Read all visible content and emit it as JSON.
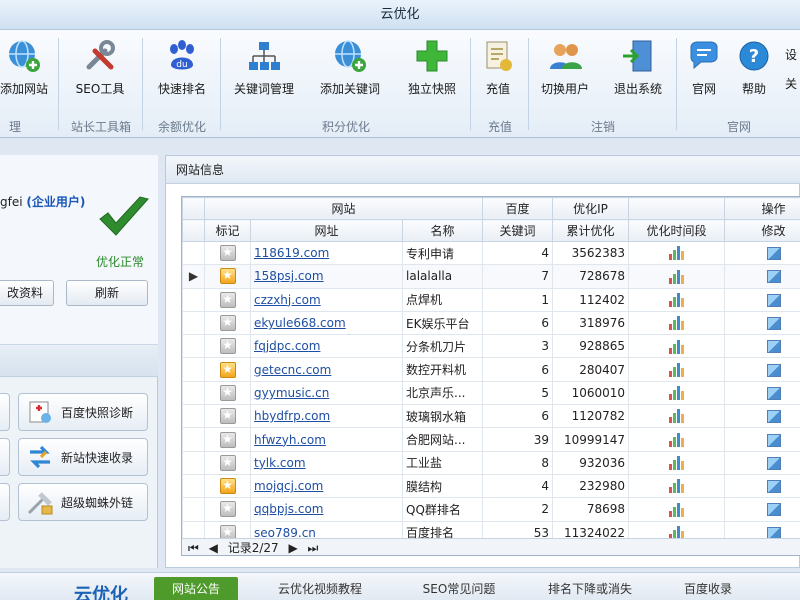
{
  "window": {
    "title": "云优化"
  },
  "ribbon": {
    "buttons": [
      {
        "label": "添加网站",
        "icon": "globe-add-icon"
      },
      {
        "label": "SEO工具",
        "icon": "tools-icon"
      },
      {
        "label": "快速排名",
        "icon": "baidu-paw-icon"
      },
      {
        "label": "关键词管理",
        "icon": "sitemap-icon"
      },
      {
        "label": "添加关键词",
        "icon": "globe-add-icon"
      },
      {
        "label": "独立快照",
        "icon": "plus-icon"
      },
      {
        "label": "充值",
        "icon": "document-icon"
      },
      {
        "label": "切换用户",
        "icon": "users-icon"
      },
      {
        "label": "退出系统",
        "icon": "exit-icon"
      },
      {
        "label": "官网",
        "icon": "chat-bubble-icon"
      },
      {
        "label": "帮助",
        "icon": "help-icon"
      },
      {
        "label": "设",
        "icon": ""
      }
    ],
    "groups": [
      "理",
      "站长工具箱",
      "余额优化",
      "积分优化",
      "充值",
      "注销",
      "官网"
    ],
    "edge_text": "关"
  },
  "user": {
    "name_prefix": "gfei",
    "vip_label": "(企业用户)",
    "status": "优化正常",
    "edit_profile_label": "改资料",
    "refresh_label": "刷新"
  },
  "left_tools": [
    {
      "label": "百度快照诊断"
    },
    {
      "label": "新站快速收录"
    },
    {
      "label": "超级蜘蛛外链"
    }
  ],
  "panel": {
    "title": "网站信息",
    "group_headers": {
      "site": "网站",
      "baidu": "百度",
      "ip": "优化IP",
      "ops": "操作"
    },
    "columns": {
      "mark": "标记",
      "url": "网址",
      "name": "名称",
      "keywords": "关键词",
      "total": "累计优化",
      "timespan": "优化时间段",
      "edit": "修改"
    },
    "rows": [
      {
        "star": "grey",
        "url": "118619.com",
        "name": "专利申请",
        "keywords": "4",
        "total": "3562383"
      },
      {
        "star": "gold",
        "url": "158psj.com",
        "name": "lalalalla",
        "keywords": "7",
        "total": "728678"
      },
      {
        "star": "grey",
        "url": "czzxhj.com",
        "name": "点焊机",
        "keywords": "1",
        "total": "112402"
      },
      {
        "star": "grey",
        "url": "ekyule668.com",
        "name": "EK娱乐平台",
        "keywords": "6",
        "total": "318976"
      },
      {
        "star": "grey",
        "url": "fqjdpc.com",
        "name": "分条机刀片",
        "keywords": "3",
        "total": "928865"
      },
      {
        "star": "gold",
        "url": "getecnc.com",
        "name": "数控开料机",
        "keywords": "6",
        "total": "280407"
      },
      {
        "star": "grey",
        "url": "gyymusic.cn",
        "name": "北京声乐...",
        "keywords": "5",
        "total": "1060010"
      },
      {
        "star": "grey",
        "url": "hbydfrp.com",
        "name": "玻璃钢水箱",
        "keywords": "6",
        "total": "1120782"
      },
      {
        "star": "grey",
        "url": "hfwzyh.com",
        "name": "合肥网站...",
        "keywords": "39",
        "total": "10999147"
      },
      {
        "star": "grey",
        "url": "tylk.com",
        "name": "工业盐",
        "keywords": "8",
        "total": "932036"
      },
      {
        "star": "gold",
        "url": "mojqcj.com",
        "name": "膜结构",
        "keywords": "4",
        "total": "232980"
      },
      {
        "star": "grey",
        "url": "qqbpjs.com",
        "name": "QQ群排名",
        "keywords": "2",
        "total": "78698"
      },
      {
        "star": "grey",
        "url": "seo789.cn",
        "name": "百度排名",
        "keywords": "53",
        "total": "11324022"
      }
    ],
    "pager": {
      "first": "⏮",
      "prev": "◀",
      "record": "记录2/27",
      "next": "▶",
      "last": "⏭"
    }
  },
  "bottom": {
    "logo": "云优化",
    "tabs": [
      "网站公告",
      "云优化视频教程",
      "SEO常见问题",
      "排名下降或消失",
      "百度收录"
    ]
  },
  "colors": {
    "accent_green": "#4e9a2a",
    "link_blue": "#1f4fa3",
    "vip_blue": "#1a56b8"
  }
}
